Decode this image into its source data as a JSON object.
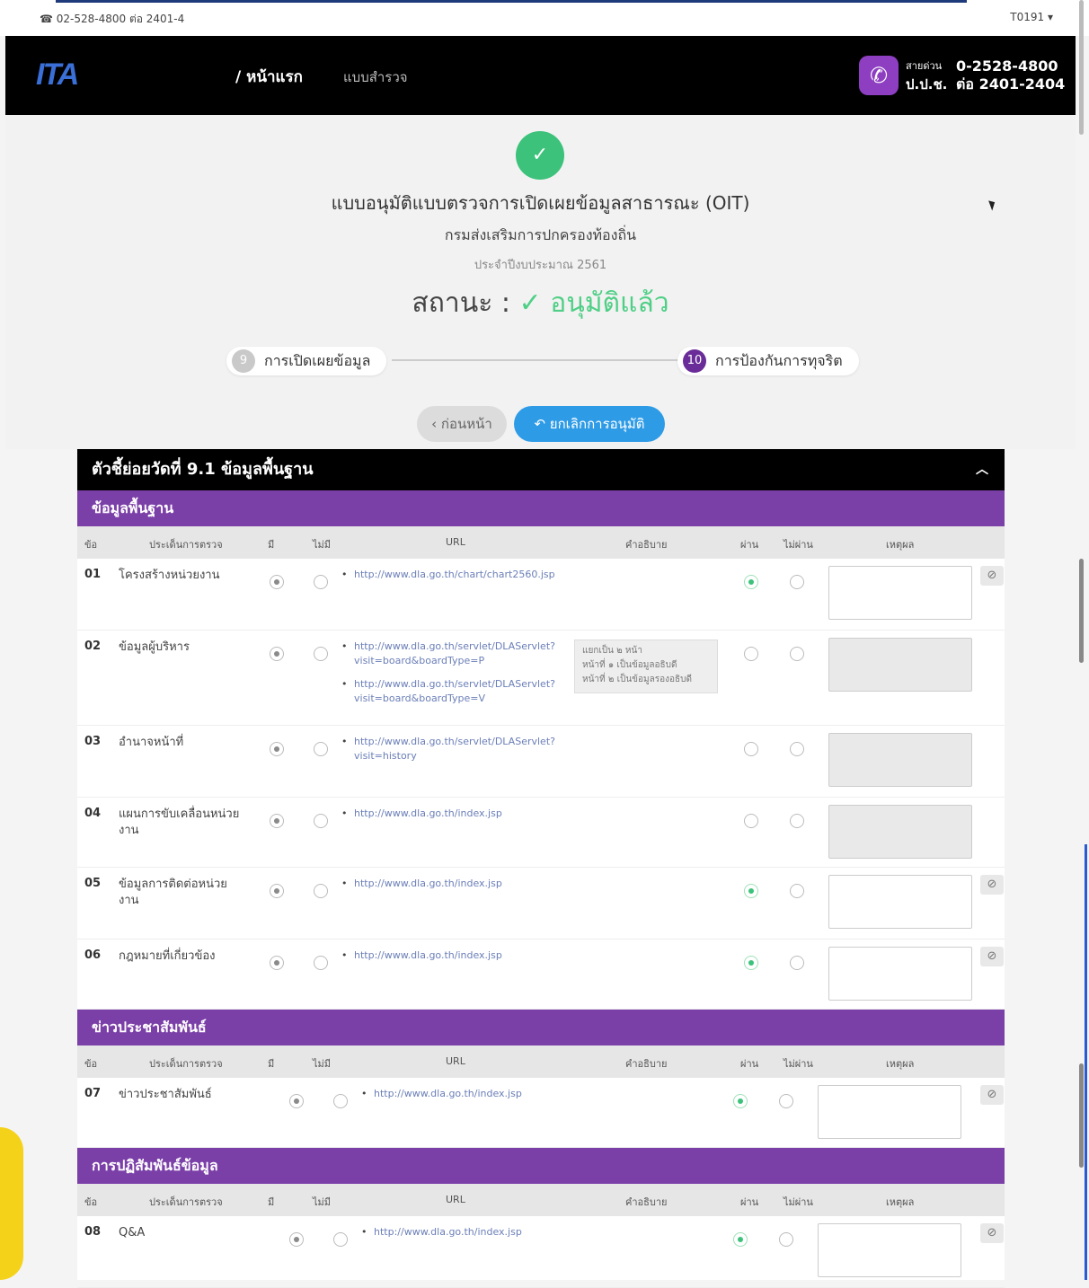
{
  "topbar": {
    "phone": "☎ 02-528-4800 ต่อ 2401-4",
    "user": "T0191 ▾"
  },
  "nav": {
    "logo": "ITA",
    "home": "/ หน้าแรก",
    "survey": "แบบสำรวจ",
    "hotline_l1": "สายด่วน",
    "hotline_l2": "ป.ป.ช.",
    "hotline_n1": "0-2528-4800",
    "hotline_n2": "ต่อ 2401-2404"
  },
  "header": {
    "title": "แบบอนุมัติแบบตรวจการเปิดเผยข้อมูลสาธารณะ (OIT)",
    "department": "กรมส่งเสริมการปกครองท้องถิ่น",
    "year": "ประจำปีงบประมาณ 2561",
    "status_label": "สถานะ :",
    "status_value": "✓ อนุมัติแล้ว"
  },
  "steps": [
    {
      "num": "9",
      "label": "การเปิดเผยข้อมูล"
    },
    {
      "num": "10",
      "label": "การป้องกันการทุจริต"
    }
  ],
  "buttons": {
    "prev": "‹ ก่อนหน้า",
    "cancel_approve": "↶ ยกเลิกการอนุมัติ"
  },
  "panel_title": "ตัวชี้ย่อยวัดที่ 9.1 ข้อมูลพื้นฐาน",
  "columns": {
    "no": "ข้อ",
    "topic": "ประเด็นการตรวจ",
    "has": "มี",
    "not_has": "ไม่มี",
    "url": "URL",
    "desc": "คำอธิบาย",
    "pass": "ผ่าน",
    "fail": "ไม่ผ่าน",
    "reason": "เหตุผล"
  },
  "sections": [
    {
      "title": "ข้อมูลพื้นฐาน"
    },
    {
      "title": "ข่าวประชาสัมพันธ์"
    },
    {
      "title": "การปฏิสัมพันธ์ข้อมูล"
    }
  ],
  "rows": [
    {
      "no": "01",
      "topic": "โครงสร้างหน่วยงาน",
      "urls": [
        "http://www.dla.go.th/chart/chart2560.jsp"
      ],
      "pass": true
    },
    {
      "no": "02",
      "topic": "ข้อมูลผู้บริหาร",
      "urls": [
        "http://www.dla.go.th/servlet/DLAServlet?visit=board&boardType=P",
        "http://www.dla.go.th/servlet/DLAServlet?visit=board&boardType=V"
      ],
      "desc": "แยกเป็น ๒ หน้า\nหน้าที่ ๑ เป็นข้อมูลอธิบดี\nหน้าที่ ๒ เป็นข้อมูลรองอธิบดี",
      "pass": false
    },
    {
      "no": "03",
      "topic": "อำนาจหน้าที่",
      "urls": [
        "http://www.dla.go.th/servlet/DLAServlet?visit=history"
      ],
      "pass": false
    },
    {
      "no": "04",
      "topic": "แผนการขับเคลื่อนหน่วยงาน",
      "urls": [
        "http://www.dla.go.th/index.jsp"
      ],
      "pass": false
    },
    {
      "no": "05",
      "topic": "ข้อมูลการติดต่อหน่วยงาน",
      "urls": [
        "http://www.dla.go.th/index.jsp"
      ],
      "pass": true
    },
    {
      "no": "06",
      "topic": "กฎหมายที่เกี่ยวข้อง",
      "urls": [
        "http://www.dla.go.th/index.jsp"
      ],
      "pass": true
    },
    {
      "no": "07",
      "topic": "ข่าวประชาสัมพันธ์",
      "urls": [
        "http://www.dla.go.th/index.jsp"
      ],
      "pass": true
    },
    {
      "no": "08",
      "topic": "Q&A",
      "urls": [
        "http://www.dla.go.th/index.jsp"
      ],
      "pass": true
    }
  ],
  "colors": {
    "purple": "#7b3fa8",
    "green": "#3cc27a",
    "blue": "#2e9be6"
  },
  "icons": {
    "clear": "ban-icon",
    "check": "check-icon",
    "phone": "phone-icon"
  }
}
